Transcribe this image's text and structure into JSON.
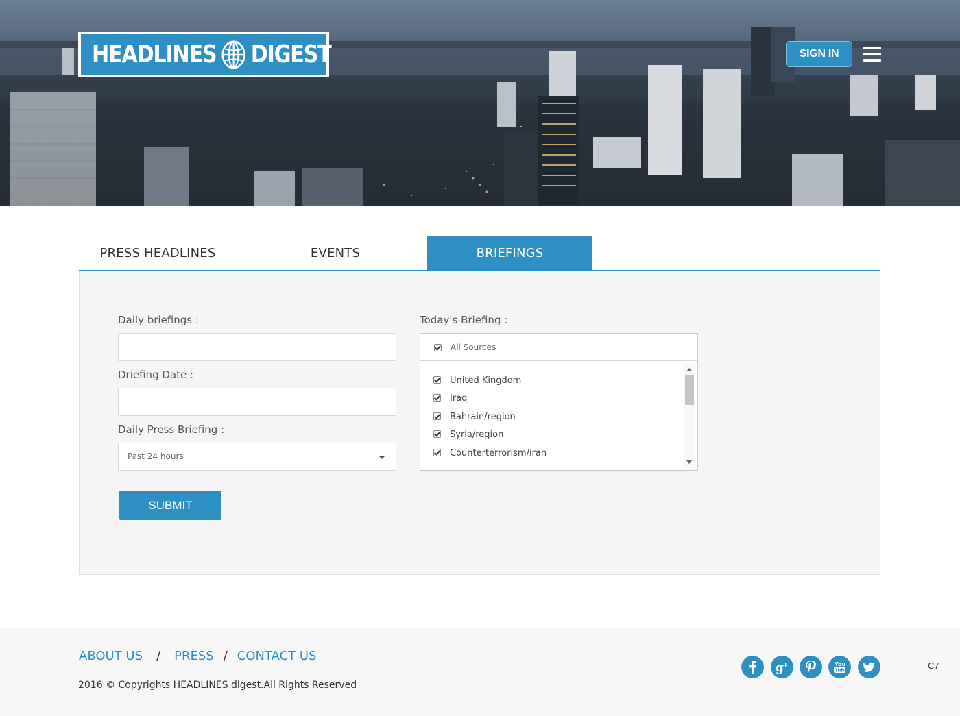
{
  "header": {
    "logo_left": "HEADLINES",
    "logo_right": "DIGEST",
    "sign_in": "SIGN IN"
  },
  "tabs": [
    {
      "label": "PRESS HEADLINES"
    },
    {
      "label": "EVENTS"
    },
    {
      "label": "BRIEFINGS",
      "active": true
    }
  ],
  "form": {
    "daily_briefings_label": "Daily briefings :",
    "daily_briefings_value": "",
    "briefing_date_label": "Driefing Date :",
    "briefing_date_value": "",
    "daily_press_label": "Daily Press Briefing :",
    "daily_press_value": "Past 24 hours",
    "submit": "SUBMIT"
  },
  "todays_briefing": {
    "label": "Today's Briefing :",
    "all_sources": "All Sources",
    "items": [
      {
        "label": "United Kingdom",
        "checked": true
      },
      {
        "label": "Iraq",
        "checked": true
      },
      {
        "label": "Bahrain/region",
        "checked": true
      },
      {
        "label": "Syria/region",
        "checked": true
      },
      {
        "label": "Counterterrorism/iran",
        "checked": true
      }
    ]
  },
  "footer": {
    "links": [
      "ABOUT US",
      "PRESS",
      "CONTACT US"
    ],
    "separator": "/",
    "copyright": "2016 © Copyrights HEADLINES digest.All Rights Reserved",
    "code": "C7",
    "social": [
      "facebook-icon",
      "google-plus-icon",
      "pinterest-icon",
      "youtube-icon",
      "twitter-icon"
    ]
  },
  "colors": {
    "accent": "#2e8fc2",
    "panel_bg": "#f5f5f5",
    "footer_bg": "#f7f7f7"
  }
}
